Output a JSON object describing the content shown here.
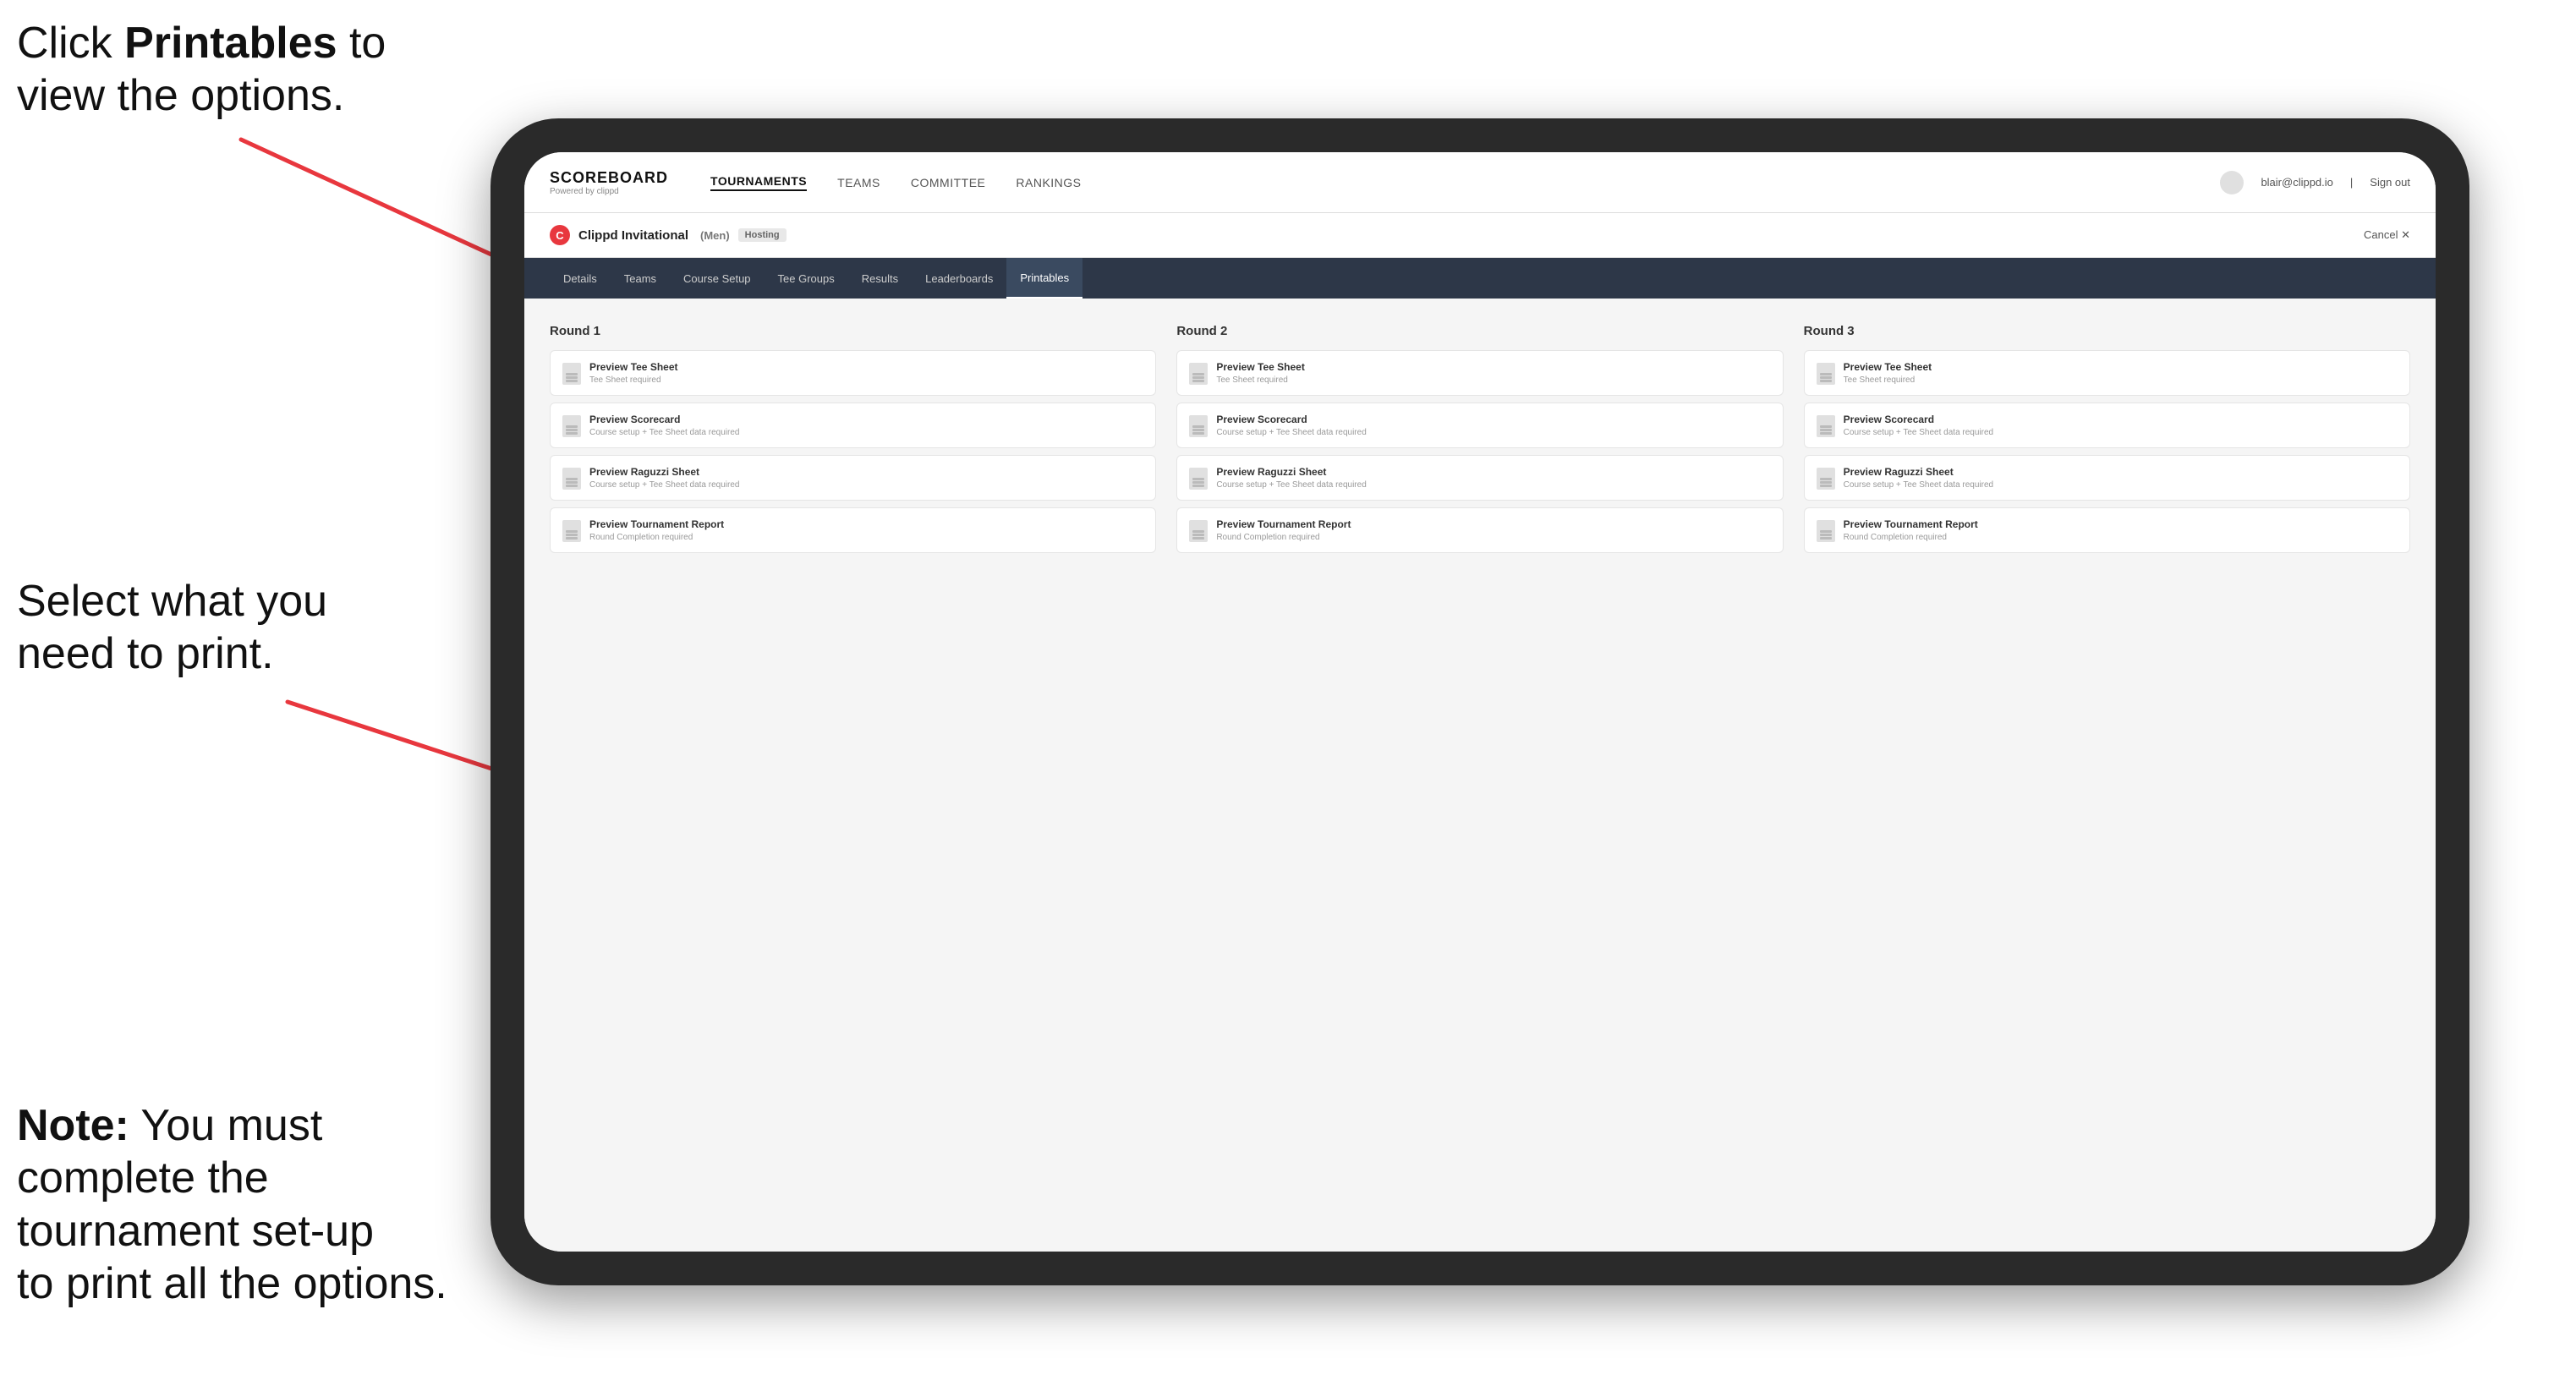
{
  "annotations": {
    "top": {
      "prefix": "Click ",
      "bold": "Printables",
      "suffix": " to\nview the options."
    },
    "middle": "Select what you\nneed to print.",
    "bottom": {
      "bold": "Note:",
      "suffix": " You must\ncomplete the\ntournament set-up\nto print all the options."
    }
  },
  "topNav": {
    "brand": "SCOREBOARD",
    "brandSub": "Powered by clippd",
    "links": [
      {
        "label": "TOURNAMENTS",
        "active": true
      },
      {
        "label": "TEAMS",
        "active": false
      },
      {
        "label": "COMMITTEE",
        "active": false
      },
      {
        "label": "RANKINGS",
        "active": false
      }
    ],
    "userEmail": "blair@clippd.io",
    "signOut": "Sign out"
  },
  "tournamentHeader": {
    "logo": "C",
    "name": "Clippd Invitational",
    "division": "(Men)",
    "status": "Hosting",
    "cancelLabel": "Cancel ✕"
  },
  "subNav": {
    "items": [
      {
        "label": "Details",
        "active": false
      },
      {
        "label": "Teams",
        "active": false
      },
      {
        "label": "Course Setup",
        "active": false
      },
      {
        "label": "Tee Groups",
        "active": false
      },
      {
        "label": "Results",
        "active": false
      },
      {
        "label": "Leaderboards",
        "active": false
      },
      {
        "label": "Printables",
        "active": true
      }
    ]
  },
  "rounds": [
    {
      "title": "Round 1",
      "cards": [
        {
          "title": "Preview Tee Sheet",
          "subtitle": "Tee Sheet required"
        },
        {
          "title": "Preview Scorecard",
          "subtitle": "Course setup + Tee Sheet data required"
        },
        {
          "title": "Preview Raguzzi Sheet",
          "subtitle": "Course setup + Tee Sheet data required"
        },
        {
          "title": "Preview Tournament Report",
          "subtitle": "Round Completion required"
        }
      ]
    },
    {
      "title": "Round 2",
      "cards": [
        {
          "title": "Preview Tee Sheet",
          "subtitle": "Tee Sheet required"
        },
        {
          "title": "Preview Scorecard",
          "subtitle": "Course setup + Tee Sheet data required"
        },
        {
          "title": "Preview Raguzzi Sheet",
          "subtitle": "Course setup + Tee Sheet data required"
        },
        {
          "title": "Preview Tournament Report",
          "subtitle": "Round Completion required"
        }
      ]
    },
    {
      "title": "Round 3",
      "cards": [
        {
          "title": "Preview Tee Sheet",
          "subtitle": "Tee Sheet required"
        },
        {
          "title": "Preview Scorecard",
          "subtitle": "Course setup + Tee Sheet data required"
        },
        {
          "title": "Preview Raguzzi Sheet",
          "subtitle": "Course setup + Tee Sheet data required"
        },
        {
          "title": "Preview Tournament Report",
          "subtitle": "Round Completion required"
        }
      ]
    }
  ]
}
